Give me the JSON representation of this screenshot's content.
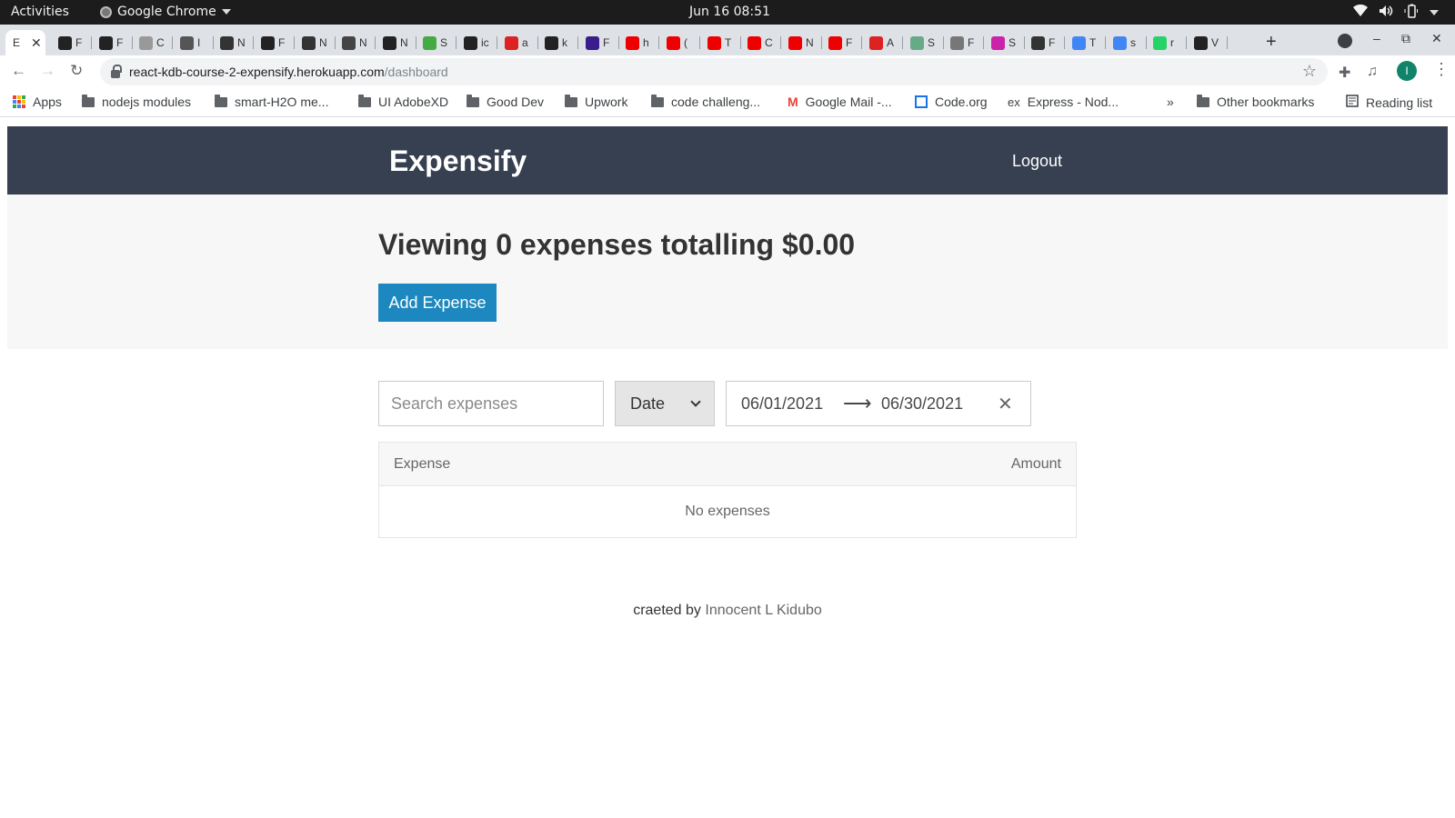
{
  "os": {
    "activities": "Activities",
    "app_name": "Google Chrome",
    "clock": "Jun 16  08:51"
  },
  "browser": {
    "active_tab_label": "E",
    "tab_initials": [
      "F",
      "F",
      "C",
      "I",
      "N",
      "F",
      "N",
      "N",
      "N",
      "S",
      "ic",
      "a",
      "k",
      "F",
      "h",
      "(",
      "T",
      "C",
      "N",
      "F",
      "A",
      "S",
      "F",
      "S",
      "F",
      "T",
      "s",
      "r",
      "V"
    ],
    "url_host": "react-kdb-course-2-expensify.herokuapp.com",
    "url_path": "/dashboard",
    "profile_initial": "I"
  },
  "bookmarks": [
    {
      "label": "Apps",
      "icon": "apps-grid-icon"
    },
    {
      "label": "nodejs modules",
      "icon": "folder-icon"
    },
    {
      "label": "smart-H2O me...",
      "icon": "folder-icon"
    },
    {
      "label": "UI AdobeXD",
      "icon": "folder-icon"
    },
    {
      "label": "Good Dev",
      "icon": "folder-icon"
    },
    {
      "label": "Upwork",
      "icon": "folder-icon"
    },
    {
      "label": "code challeng...",
      "icon": "folder-icon"
    },
    {
      "label": "Google Mail -...",
      "icon": "gmail-icon"
    },
    {
      "label": "Code.org",
      "icon": "code-org-icon"
    },
    {
      "label": "Express - Nod...",
      "icon": "express-icon"
    }
  ],
  "bookmarks_overflow": "»",
  "other_bookmarks": "Other bookmarks",
  "reading_list": "Reading list",
  "app": {
    "brand": "Expensify",
    "logout_label": "Logout",
    "summary": {
      "prefix": "Viewing",
      "count": "0",
      "middle": "expenses totalling",
      "total": "$0.00"
    },
    "add_expense_label": "Add Expense",
    "filters": {
      "search_placeholder": "Search expenses",
      "search_value": "",
      "sort_by_selected": "Date",
      "start_date": "06/01/2021",
      "end_date": "06/30/2021"
    },
    "table": {
      "col_expense": "Expense",
      "col_amount": "Amount",
      "empty_message": "No expenses"
    },
    "footer": {
      "prefix": "craeted by",
      "author": "Innocent L Kidubo"
    }
  },
  "colors": {
    "header_bg": "#364051",
    "primary_button": "#1c88bf",
    "summary_bg": "#f7f7f7"
  }
}
